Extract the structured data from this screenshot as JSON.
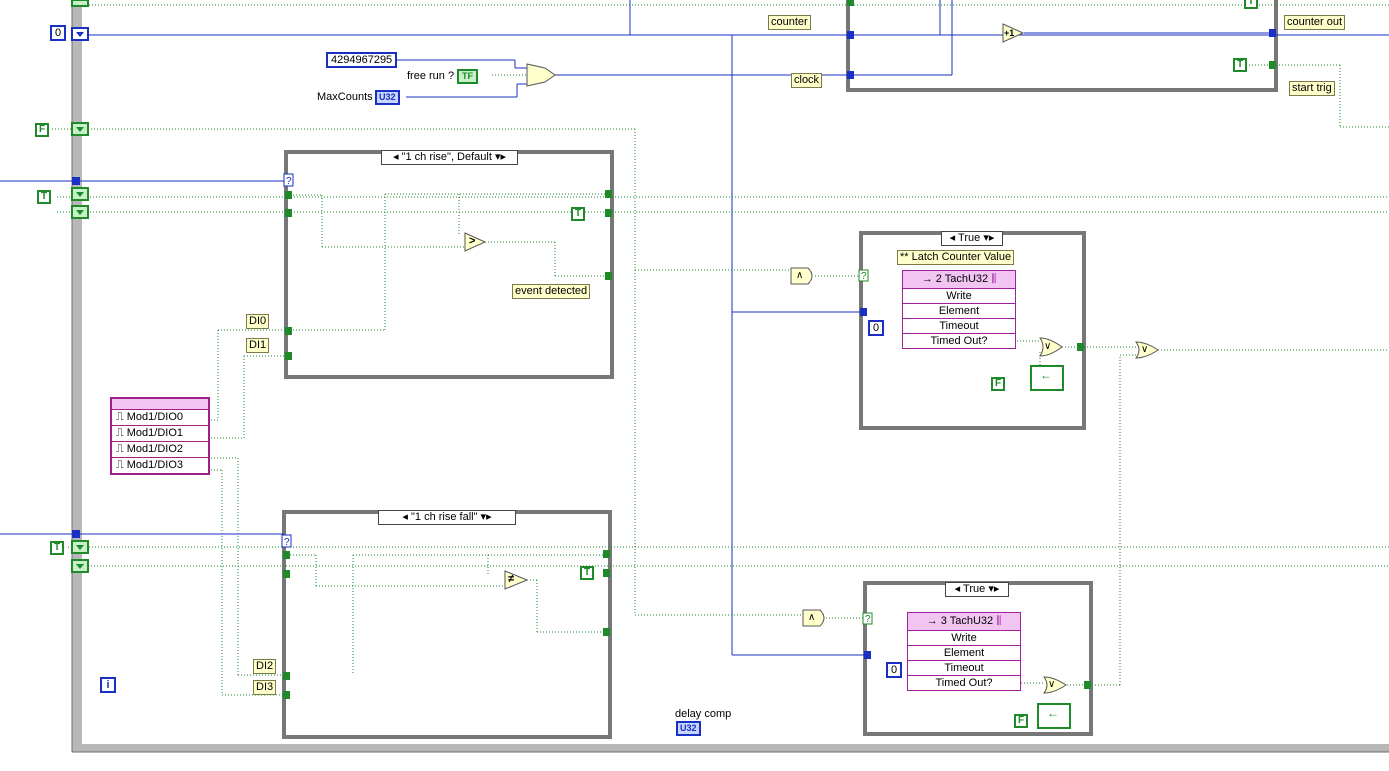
{
  "constants": {
    "zero_top": "0",
    "max_u32": "4294967295",
    "zero_q1": "0",
    "zero_q2": "0"
  },
  "booleans": {
    "false_a": "F",
    "true_a": "T",
    "true_b": "T",
    "true_c": "T",
    "true_d": "T",
    "false_b": "F",
    "false_c": "F"
  },
  "labels": {
    "counter": "counter",
    "clock": "clock",
    "counter_out": "counter out",
    "start_trig": "start trig",
    "free_run": "free run ?",
    "max_counts": "MaxCounts",
    "event_detected": "event detected",
    "di0": "DI0",
    "di1": "DI1",
    "di2": "DI2",
    "di3": "DI3",
    "delay_comp": "delay comp",
    "latch": "** Latch Counter Value",
    "loop_index": "i"
  },
  "terminals": {
    "free_run_type": "TF",
    "max_counts_type": "U32",
    "delay_comp_type": "U32"
  },
  "case_structures": {
    "case1": "\"1 ch rise\", Default",
    "case2": "\"1 ch rise fall\"",
    "case3": "True",
    "case4": "True"
  },
  "queue1": {
    "title": "2 TachU32",
    "rows": [
      "Write",
      "Element",
      "Timeout",
      "Timed Out?"
    ]
  },
  "queue2": {
    "title": "3 TachU32",
    "rows": [
      "Write",
      "Element",
      "Timeout",
      "Timed Out?"
    ]
  },
  "io_module": {
    "channels": [
      "Mod1/DIO0",
      "Mod1/DIO1",
      "Mod1/DIO2",
      "Mod1/DIO3"
    ]
  },
  "operators": {
    "increment": "+1",
    "greater": ">",
    "not_equal": "≠",
    "and1": "∧",
    "and2": "∧",
    "or1": "∨",
    "or2": "∨",
    "or3": "∨"
  },
  "colors": {
    "wire_numeric": "#1a2fc4",
    "wire_boolean": "#1f8a2a",
    "frame": "#7a7a7a",
    "queue": "#a020a0",
    "label_bg": "#ffffcc"
  }
}
